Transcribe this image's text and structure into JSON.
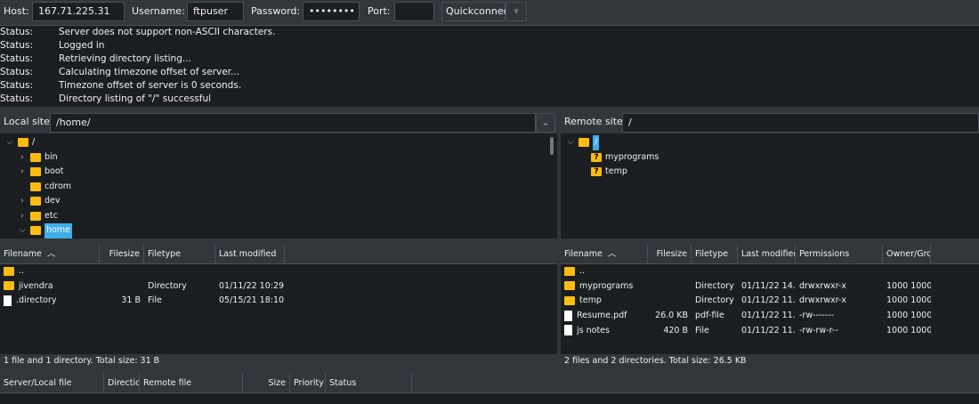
{
  "toolbar": {
    "host_label": "Host:",
    "host": "167.71.225.31",
    "username_label": "Username:",
    "username": "ftpuser",
    "password_label": "Password:",
    "password": "••••••••",
    "port_label": "Port:",
    "port": "",
    "quickconnect": "Quickconnect"
  },
  "log": [
    {
      "k": "Status:",
      "v": "Server does not support non-ASCII characters."
    },
    {
      "k": "Status:",
      "v": "Logged in"
    },
    {
      "k": "Status:",
      "v": "Retrieving directory listing..."
    },
    {
      "k": "Status:",
      "v": "Calculating timezone offset of server..."
    },
    {
      "k": "Status:",
      "v": "Timezone offset of server is 0 seconds."
    },
    {
      "k": "Status:",
      "v": "Directory listing of \"/\" successful"
    }
  ],
  "local": {
    "site_label": "Local site:",
    "path": "/home/",
    "tree": [
      {
        "name": "/",
        "depth": 0,
        "chev": "v"
      },
      {
        "name": "bin",
        "depth": 1,
        "chev": ">"
      },
      {
        "name": "boot",
        "depth": 1,
        "chev": ">"
      },
      {
        "name": "cdrom",
        "depth": 1,
        "chev": ""
      },
      {
        "name": "dev",
        "depth": 1,
        "chev": ">"
      },
      {
        "name": "etc",
        "depth": 1,
        "chev": ">"
      },
      {
        "name": "home",
        "depth": 1,
        "chev": "v",
        "selected": true
      }
    ],
    "columns": [
      "Filename",
      "Filesize",
      "Filetype",
      "Last modified"
    ],
    "files": [
      {
        "name": "..",
        "size": "",
        "type": "",
        "modified": "",
        "icon": "folder"
      },
      {
        "name": "jivendra",
        "size": "",
        "type": "Directory",
        "modified": "01/11/22 10:29...",
        "icon": "folder"
      },
      {
        "name": ".directory",
        "size": "31 B",
        "type": "File",
        "modified": "05/15/21 18:10...",
        "icon": "file"
      }
    ],
    "status": "1 file and 1 directory. Total size: 31 B"
  },
  "remote": {
    "site_label": "Remote site:",
    "path": "/",
    "tree": [
      {
        "name": "/",
        "depth": 0,
        "chev": "v",
        "selected": true
      },
      {
        "name": "myprograms",
        "depth": 1,
        "chev": "",
        "unknown": true
      },
      {
        "name": "temp",
        "depth": 1,
        "chev": "",
        "unknown": true
      }
    ],
    "columns": [
      "Filename",
      "Filesize",
      "Filetype",
      "Last modified",
      "Permissions",
      "Owner/Grou"
    ],
    "files": [
      {
        "name": "..",
        "size": "",
        "type": "",
        "modified": "",
        "perms": "",
        "owner": "",
        "icon": "folder"
      },
      {
        "name": "myprograms",
        "size": "",
        "type": "Directory",
        "modified": "01/11/22 14...",
        "perms": "drwxrwxr-x",
        "owner": "1000 1000",
        "icon": "folder"
      },
      {
        "name": "temp",
        "size": "",
        "type": "Directory",
        "modified": "01/11/22 11...",
        "perms": "drwxrwxr-x",
        "owner": "1000 1000",
        "icon": "folder"
      },
      {
        "name": "Resume.pdf",
        "size": "26.0 KB",
        "type": "pdf-file",
        "modified": "01/11/22 11...",
        "perms": "-rw-------",
        "owner": "1000 1000",
        "icon": "file"
      },
      {
        "name": "js notes",
        "size": "420 B",
        "type": "File",
        "modified": "01/11/22 11...",
        "perms": "-rw-rw-r--",
        "owner": "1000 1000",
        "icon": "file"
      }
    ],
    "status": "2 files and 2 directories. Total size: 26.5 KB"
  },
  "queue": {
    "columns": [
      "Server/Local file",
      "Direction",
      "Remote file",
      "Size",
      "Priority",
      "Status"
    ]
  }
}
